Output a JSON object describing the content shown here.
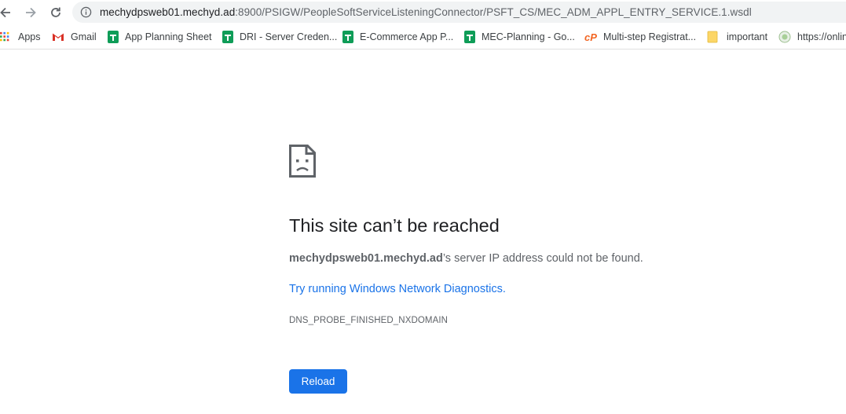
{
  "browser": {
    "url_host": "mechydpsweb01.mechyd.ad",
    "url_rest": ":8900/PSIGW/PeopleSoftServiceListeningConnector/PSFT_CS/MEC_ADM_APPL_ENTRY_SERVICE.1.wsdl"
  },
  "bookmarks": [
    {
      "label": "Apps",
      "icon": "apps-grid-icon"
    },
    {
      "label": "Gmail",
      "icon": "gmail-icon"
    },
    {
      "label": "App Planning Sheet",
      "icon": "sheets-icon"
    },
    {
      "label": "DRI - Server Creden...",
      "icon": "sheets-icon"
    },
    {
      "label": "E-Commerce App P...",
      "icon": "sheets-icon"
    },
    {
      "label": "MEC-Planning - Go...",
      "icon": "sheets-icon"
    },
    {
      "label": "Multi-step Registrat...",
      "icon": "codepen-cp-icon"
    },
    {
      "label": "important",
      "icon": "folder-icon"
    },
    {
      "label": "https://onlin",
      "icon": "globe-icon"
    }
  ],
  "error": {
    "title": "This site can’t be reached",
    "host": "mechydpsweb01.mechyd.ad",
    "message_suffix": "’s server IP address could not be found.",
    "diagnostics_link": "Try running Windows Network Diagnostics.",
    "code": "DNS_PROBE_FINISHED_NXDOMAIN",
    "reload_label": "Reload"
  },
  "colors": {
    "accent": "#1a73e8",
    "text": "#202124",
    "secondary_text": "#5f6368",
    "omnibox_bg": "#f1f3f4"
  }
}
